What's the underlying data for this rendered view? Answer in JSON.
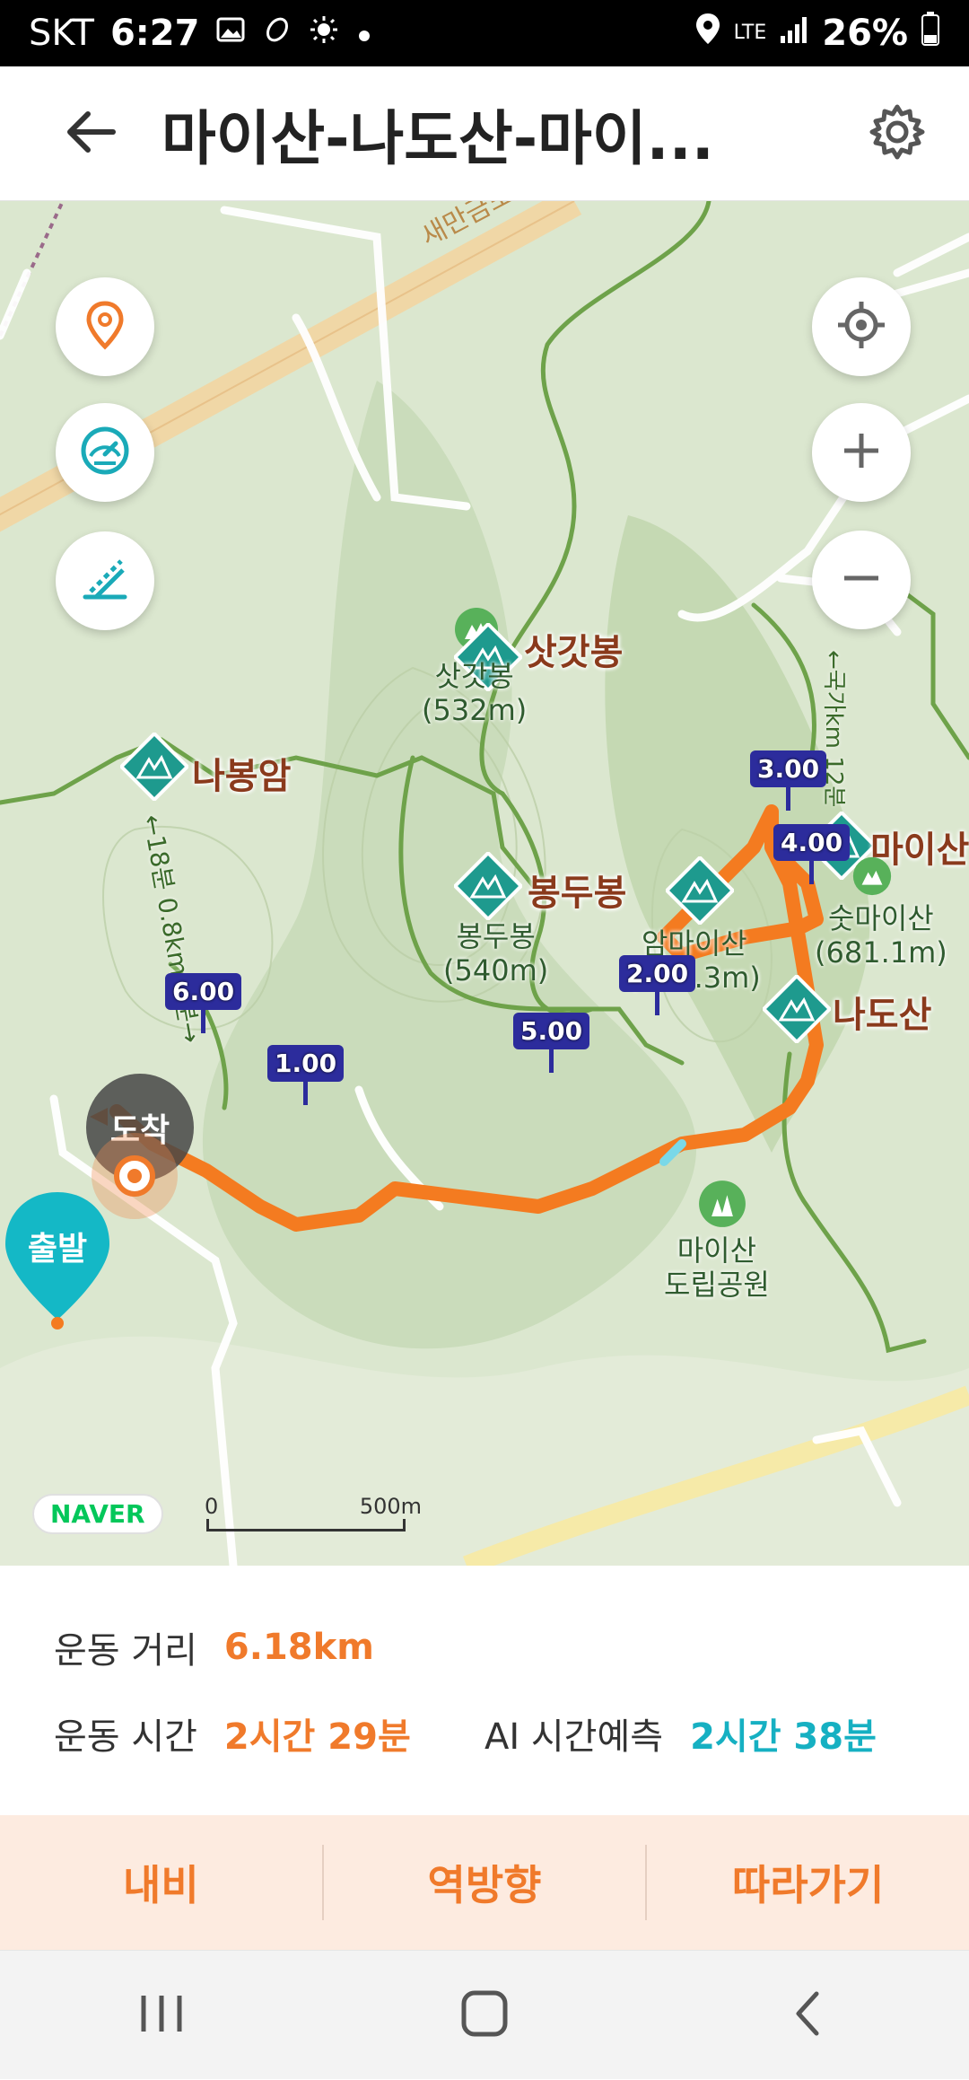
{
  "status_bar": {
    "carrier": "SKT",
    "time": "6:27",
    "battery": "26%",
    "network": "LTE"
  },
  "header": {
    "title": "마이산-나도산-마이...",
    "back_icon": "arrow-left-icon",
    "settings_icon": "gear-icon"
  },
  "map": {
    "road_label": "새만금포항",
    "peaks": [
      {
        "name": "삿갓봉",
        "sub1": "삿갓봉",
        "sub2": "(532m)"
      },
      {
        "name": "나봉암"
      },
      {
        "name": "봉두봉",
        "sub1": "봉두봉",
        "sub2": "(540m)"
      },
      {
        "name": "마이산"
      },
      {
        "name": "나도산"
      },
      {
        "sub1": "암마이산",
        "sub2": "(687.3m)"
      },
      {
        "sub1": "숫마이산",
        "sub2": "(681.1m)"
      }
    ],
    "park": {
      "line1": "마이산",
      "line2": "도립공원"
    },
    "trail_labels": [
      "←18분 0.8km 1분→",
      "←국가km 12분"
    ],
    "km_markers": [
      "1.00",
      "2.00",
      "3.00",
      "4.00",
      "5.00",
      "6.00"
    ],
    "start_label": "출발",
    "arrive_label": "도착",
    "brand": "NAVER",
    "scale": {
      "zero": "0",
      "max": "500m"
    }
  },
  "stats": {
    "distance_label": "운동 거리",
    "distance_value": "6.18km",
    "time_label": "운동 시간",
    "time_value": "2시간 29분",
    "ai_label": "AI 시간예측",
    "ai_value": "2시간 38분"
  },
  "actions": {
    "navi": "내비",
    "reverse": "역방향",
    "follow": "따라가기"
  },
  "colors": {
    "route": "#f47b20",
    "accent": "#f07a2b",
    "ai": "#16b0c2",
    "peak_icon": "#1e9a8e",
    "marker": "#2c2c9c"
  }
}
